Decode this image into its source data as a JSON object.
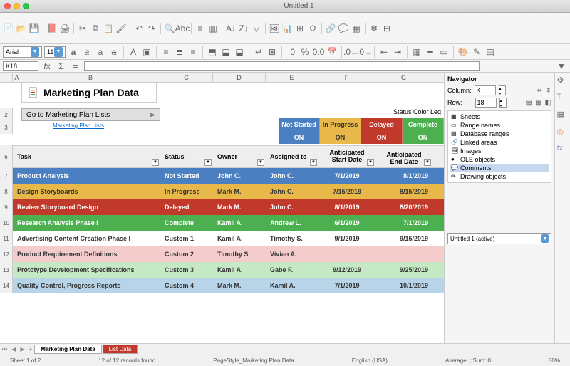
{
  "window": {
    "title": "Untitled 1"
  },
  "format": {
    "font": "Arial",
    "size": "11"
  },
  "cellref": "K18",
  "sheet_title": "Marketing Plan Data",
  "goto_label": "Go to Marketing Plan Lists",
  "link_label": "Marketing Plan Lists",
  "status_legend_title": "Status Color Leg",
  "columns": [
    "A",
    "B",
    "C",
    "D",
    "E",
    "F",
    "G"
  ],
  "row_numbers": [
    "2",
    "3",
    "6",
    "7",
    "8",
    "9",
    "10",
    "11",
    "12",
    "13",
    "14"
  ],
  "statuses": {
    "not_started": "Not Started",
    "in_progress": "In Progress",
    "delayed": "Delayed",
    "complete": "Complete",
    "on": "ON"
  },
  "headers": {
    "task": "Task",
    "status": "Status",
    "owner": "Owner",
    "assigned": "Assigned to",
    "start": "Anticipated Start Date",
    "end": "Anticipated End Date"
  },
  "rows": [
    {
      "task": "Product Analysis",
      "status": "Not Started",
      "owner": "John C.",
      "assigned": "John C.",
      "start": "7/1/2019",
      "end": "8/1/2019",
      "cls": "r-blue"
    },
    {
      "task": "Design Storyboards",
      "status": "In Progress",
      "owner": "Mark M.",
      "assigned": "John C.",
      "start": "7/15/2019",
      "end": "8/15/2019",
      "cls": "r-yellow"
    },
    {
      "task": "Review Storyboard Design",
      "status": "Delayed",
      "owner": "Mark M.",
      "assigned": "John C.",
      "start": "8/1/2019",
      "end": "8/20/2019",
      "cls": "r-red"
    },
    {
      "task": "Research Analysis Phase I",
      "status": "Complete",
      "owner": "Kamil A.",
      "assigned": "Andrew L.",
      "start": "6/1/2019",
      "end": "7/1/2019",
      "cls": "r-green"
    },
    {
      "task": "Advertising Content Creation Phase I",
      "status": "Custom 1",
      "owner": "Kamil A.",
      "assigned": "Timothy S.",
      "start": "9/1/2019",
      "end": "9/15/2019",
      "cls": "r-white"
    },
    {
      "task": "Product Requirement Definitions",
      "status": "Custom 2",
      "owner": "Timothy S.",
      "assigned": "Vivian A.",
      "start": "",
      "end": "",
      "cls": "r-pink"
    },
    {
      "task": "Prototype Development Specifications",
      "status": "Custom 3",
      "owner": "Kamil A.",
      "assigned": "Gabe F.",
      "start": "9/12/2019",
      "end": "9/25/2019",
      "cls": "r-ltgreen"
    },
    {
      "task": "Quality Control, Progress Reports",
      "status": "Custom 4",
      "owner": "Mark M.",
      "assigned": "Kamil A.",
      "start": "7/1/2019",
      "end": "10/1/2019",
      "cls": "r-ltblue"
    }
  ],
  "navigator": {
    "title": "Navigator",
    "col_label": "Column:",
    "col_val": "K",
    "row_label": "Row:",
    "row_val": "18",
    "items": [
      "Sheets",
      "Range names",
      "Database ranges",
      "Linked areas",
      "Images",
      "OLE objects",
      "Comments",
      "Drawing objects"
    ],
    "selected_idx": 6,
    "doc": "Untitled 1 (active)"
  },
  "tabs": {
    "t1": "Marketing Plan Data",
    "t2": "List Data"
  },
  "statusbar": {
    "sheet": "Sheet 1 of 2",
    "records": "12 of 12 records found",
    "pagestyle": "PageStyle_Marketing Plan Data",
    "lang": "English (USA)",
    "avg": "Average: ; Sum: 0",
    "zoom": "80%"
  }
}
